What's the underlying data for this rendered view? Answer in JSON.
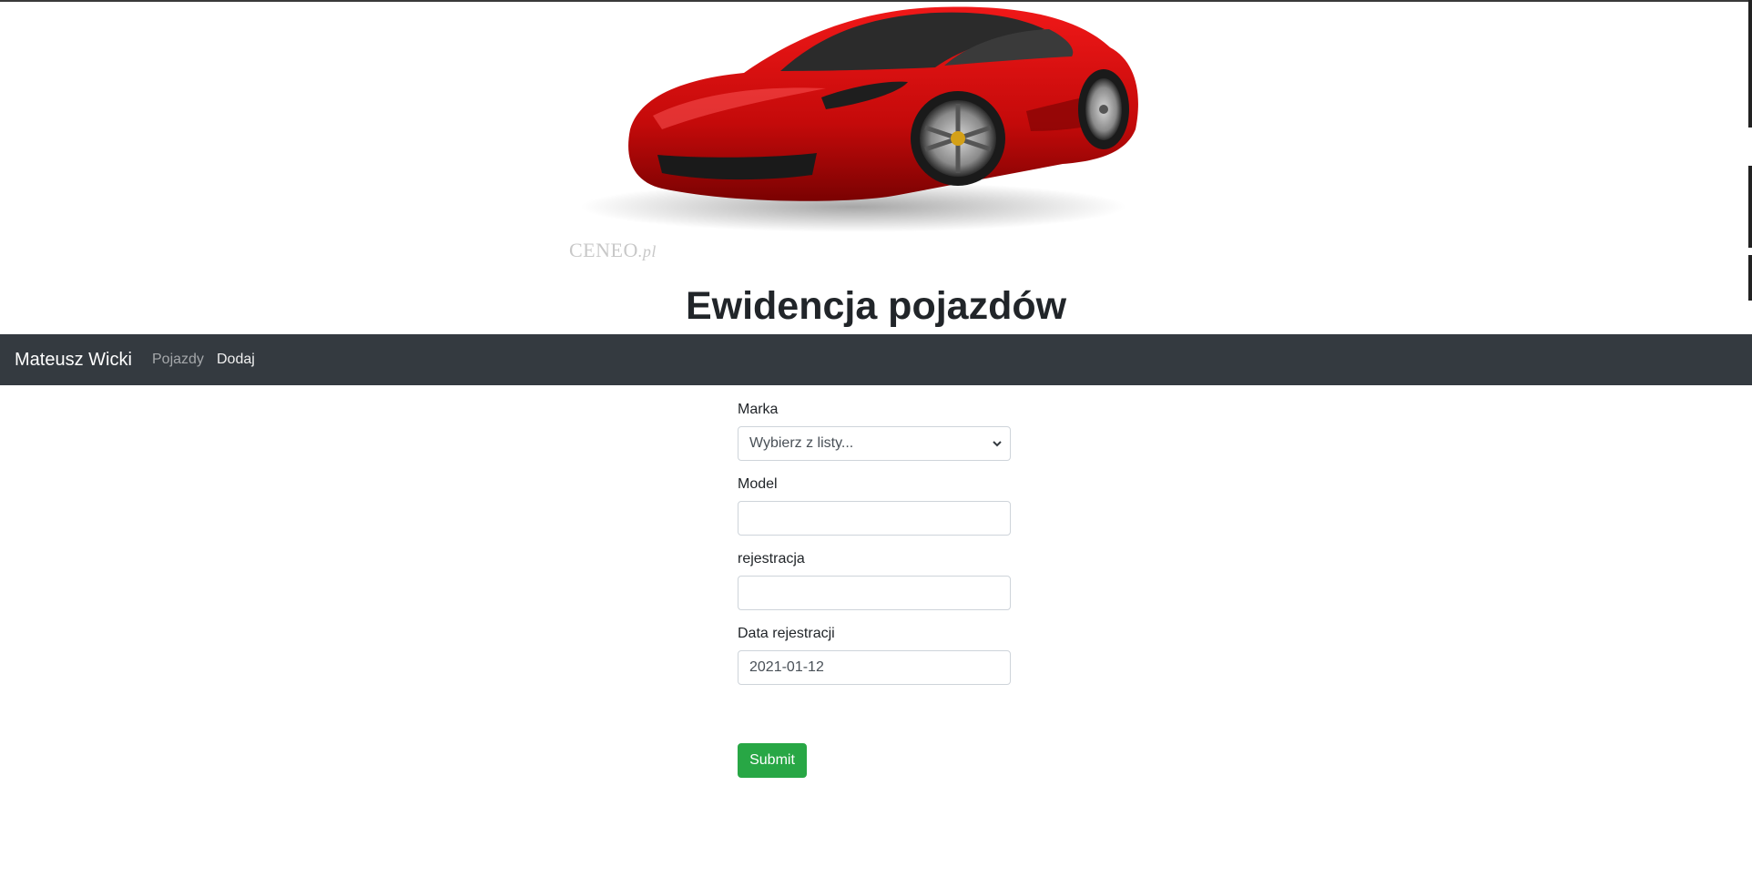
{
  "header": {
    "title": "Ewidencja pojazdów",
    "image": {
      "alt": "red sports car",
      "watermark_main": "CENEO",
      "watermark_suffix": ".pl"
    }
  },
  "navbar": {
    "brand": "Mateusz Wicki",
    "links": [
      {
        "label": "Pojazdy",
        "active": false
      },
      {
        "label": "Dodaj",
        "active": true
      }
    ],
    "background": "#343a40"
  },
  "form": {
    "fields": [
      {
        "label": "Marka",
        "type": "select",
        "value": "Wybierz z listy..."
      },
      {
        "label": "Model",
        "type": "text",
        "value": ""
      },
      {
        "label": "rejestracja",
        "type": "text",
        "value": ""
      },
      {
        "label": "Data rejestracji",
        "type": "date",
        "value": "2021-01-12"
      }
    ],
    "submit_label": "Submit",
    "submit_color": "#28a745"
  }
}
